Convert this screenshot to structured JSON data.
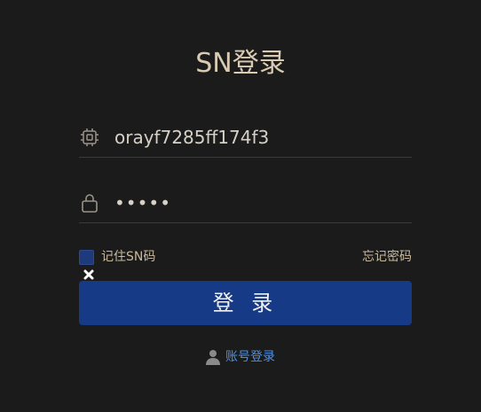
{
  "page": {
    "title": "SN登录"
  },
  "form": {
    "sn_value": "orayf7285ff174f3",
    "password_masked": "•••••",
    "remember_label": "记住SN码",
    "forgot_label": "忘记密码",
    "login_label": "登 录"
  },
  "footer": {
    "account_login_label": "账号登录"
  },
  "colors": {
    "background": "#1b1b1b",
    "title": "#d9cbb2",
    "button": "#173a86",
    "link": "#4f8fe0",
    "checkbox": "#1f3a7a"
  },
  "icons": {
    "sn_field": "chip-icon",
    "password_field": "lock-icon",
    "close": "close-icon",
    "account": "user-icon"
  }
}
